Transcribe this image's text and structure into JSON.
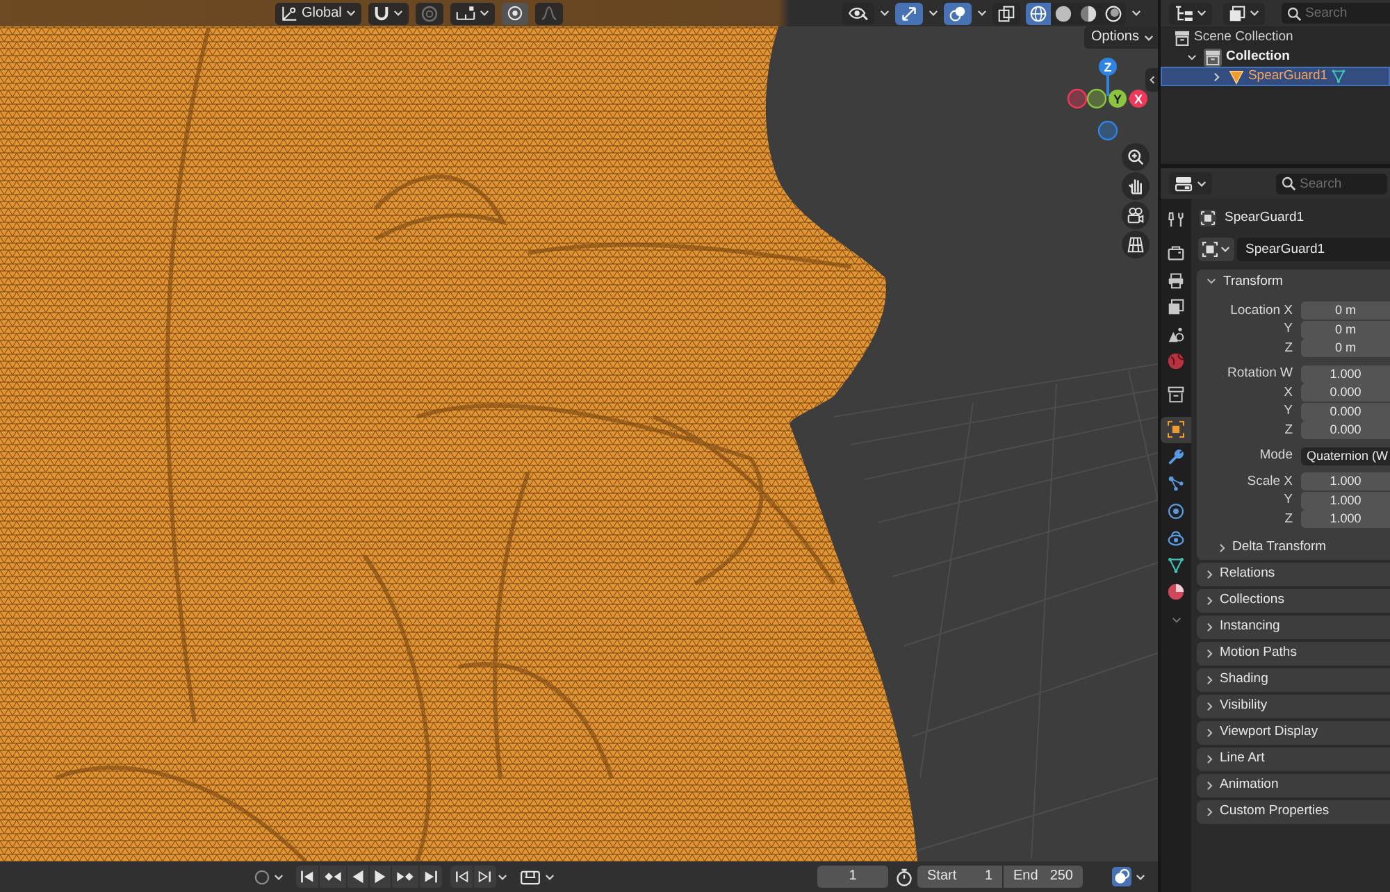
{
  "viewport": {
    "header": {
      "orientation": "Global",
      "tools": [
        {
          "kind": "snap",
          "disabled": false
        },
        {
          "kind": "snap_target",
          "disabled": true
        },
        {
          "kind": "increment",
          "disabled": false
        },
        {
          "kind": "proportional",
          "disabled": false
        },
        {
          "kind": "falloff",
          "disabled": true
        }
      ],
      "toggles": [
        {
          "kind": "visibility",
          "on": false
        },
        {
          "kind": "gizmos",
          "on": true
        },
        {
          "kind": "overlays",
          "on": true
        },
        {
          "kind": "xray",
          "on": false
        }
      ],
      "shading": [
        {
          "kind": "wireframe",
          "selected": true
        },
        {
          "kind": "solid",
          "selected": false
        },
        {
          "kind": "material",
          "selected": false
        },
        {
          "kind": "rendered",
          "selected": false
        }
      ]
    },
    "options": "Options",
    "axes": [
      {
        "label": "Z",
        "color": "#2f83e3"
      },
      {
        "label": "Y",
        "color": "#8bc53f"
      },
      {
        "label": "X",
        "color": "#f0385b"
      }
    ]
  },
  "outliner": {
    "search": {
      "placeholder": "Search"
    },
    "tree": [
      {
        "kind": "scene_collection",
        "label": "Scene Collection",
        "selected": false,
        "children": [
          {
            "kind": "collection",
            "label": "Collection",
            "selected": false,
            "expanded": true,
            "children": [
              {
                "kind": "object",
                "label": "SpearGuard1",
                "selected": true,
                "expanded": false
              }
            ]
          }
        ]
      }
    ]
  },
  "properties": {
    "search": {
      "placeholder": "Search"
    },
    "tabs": [
      {
        "kind": "tool",
        "selected": false
      },
      {
        "kind": "render",
        "selected": false
      },
      {
        "kind": "output",
        "selected": false
      },
      {
        "kind": "view_layer",
        "selected": false
      },
      {
        "kind": "scene",
        "selected": false
      },
      {
        "kind": "world",
        "selected": false
      },
      {
        "kind": "collection",
        "selected": false
      },
      {
        "kind": "object",
        "selected": true
      },
      {
        "kind": "modifiers",
        "selected": false
      },
      {
        "kind": "particles",
        "selected": false
      },
      {
        "kind": "physics",
        "selected": false
      },
      {
        "kind": "constraints",
        "selected": false
      },
      {
        "kind": "data",
        "selected": false
      },
      {
        "kind": "material",
        "selected": false
      }
    ],
    "context": "SpearGuard1",
    "object_name": "SpearGuard1",
    "transform": {
      "title": "Transform",
      "expanded": true,
      "groups": [
        {
          "rows": [
            {
              "kind": "number",
              "label": "Location X",
              "value": "0 m"
            },
            {
              "kind": "number",
              "label": "Y",
              "value": "0 m"
            },
            {
              "kind": "number",
              "label": "Z",
              "value": "0 m"
            }
          ]
        },
        {
          "rows": [
            {
              "kind": "number",
              "label": "Rotation W",
              "value": "1.000"
            },
            {
              "kind": "number",
              "label": "X",
              "value": "0.000"
            },
            {
              "kind": "number",
              "label": "Y",
              "value": "0.000"
            },
            {
              "kind": "number",
              "label": "Z",
              "value": "0.000"
            }
          ]
        },
        {
          "rows": [
            {
              "kind": "dropdown",
              "label": "Mode",
              "value": "Quaternion (W"
            }
          ]
        },
        {
          "rows": [
            {
              "kind": "number",
              "label": "Scale X",
              "value": "1.000"
            },
            {
              "kind": "number",
              "label": "Y",
              "value": "1.000"
            },
            {
              "kind": "number",
              "label": "Z",
              "value": "1.000"
            }
          ]
        }
      ],
      "subpanels": [
        {
          "title": "Delta Transform",
          "expanded": false
        }
      ]
    },
    "panels": [
      {
        "title": "Relations",
        "expanded": false
      },
      {
        "title": "Collections",
        "expanded": false
      },
      {
        "title": "Instancing",
        "expanded": false
      },
      {
        "title": "Motion Paths",
        "expanded": false
      },
      {
        "title": "Shading",
        "expanded": false
      },
      {
        "title": "Visibility",
        "expanded": false
      },
      {
        "title": "Viewport Display",
        "expanded": false
      },
      {
        "title": "Line Art",
        "expanded": false
      },
      {
        "title": "Animation",
        "expanded": false
      },
      {
        "title": "Custom Properties",
        "expanded": false
      }
    ]
  },
  "timeline": {
    "auto_keying": {
      "on": false
    },
    "current_frame": "1",
    "start": {
      "label": "Start",
      "value": "1"
    },
    "end": {
      "label": "End",
      "value": "250"
    }
  }
}
